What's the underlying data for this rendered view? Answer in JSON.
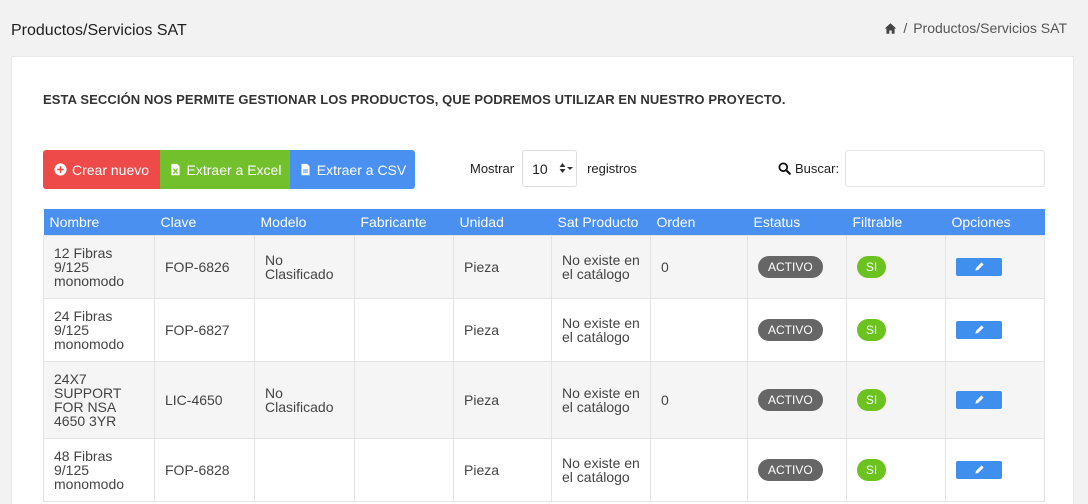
{
  "header": {
    "title": "Productos/Servicios SAT",
    "breadcrumb": {
      "home_icon": "home-icon",
      "separator": "/",
      "current": "Productos/Servicios SAT"
    }
  },
  "intro_text": "ESTA SECCIÓN NOS PERMITE GESTIONAR LOS PRODUCTOS, QUE PODREMOS UTILIZAR EN NUESTRO PROYECTO.",
  "toolbar": {
    "create_label": "Crear nuevo",
    "excel_label": "Extraer a Excel",
    "csv_label": "Extraer a CSV"
  },
  "length_menu": {
    "prefix": "Mostrar",
    "value": "10",
    "suffix": "registros"
  },
  "search": {
    "label": "Buscar:",
    "value": ""
  },
  "colors": {
    "header": "#4a90f0",
    "create": "#ef4a4a",
    "excel": "#72c02c",
    "csv": "#4a90f0",
    "status": "#666666",
    "si": "#6cc31f"
  },
  "table": {
    "columns": [
      "Nombre",
      "Clave",
      "Modelo",
      "Fabricante",
      "Unidad",
      "Sat Producto",
      "Orden",
      "Estatus",
      "Filtrable",
      "Opciones"
    ],
    "rows": [
      {
        "nombre": "12 Fibras 9/125 monomodo",
        "clave": "FOP-6826",
        "modelo": "No Clasificado",
        "fabricante": "",
        "unidad": "Pieza",
        "sat": "No existe en el catálogo",
        "orden": "0",
        "estatus": "ACTIVO",
        "filtrable": "SI"
      },
      {
        "nombre": "24 Fibras 9/125 monomodo",
        "clave": "FOP-6827",
        "modelo": "",
        "fabricante": "",
        "unidad": "Pieza",
        "sat": "No existe en el catálogo",
        "orden": "",
        "estatus": "ACTIVO",
        "filtrable": "SI"
      },
      {
        "nombre": "24X7 SUPPORT FOR NSA 4650 3YR",
        "clave": "LIC-4650",
        "modelo": "No Clasificado",
        "fabricante": "",
        "unidad": "Pieza",
        "sat": "No existe en el catálogo",
        "orden": "0",
        "estatus": "ACTIVO",
        "filtrable": "SI"
      },
      {
        "nombre": "48 Fibras 9/125 monomodo",
        "clave": "FOP-6828",
        "modelo": "",
        "fabricante": "",
        "unidad": "Pieza",
        "sat": "No existe en el catálogo",
        "orden": "",
        "estatus": "ACTIVO",
        "filtrable": "SI"
      }
    ]
  }
}
